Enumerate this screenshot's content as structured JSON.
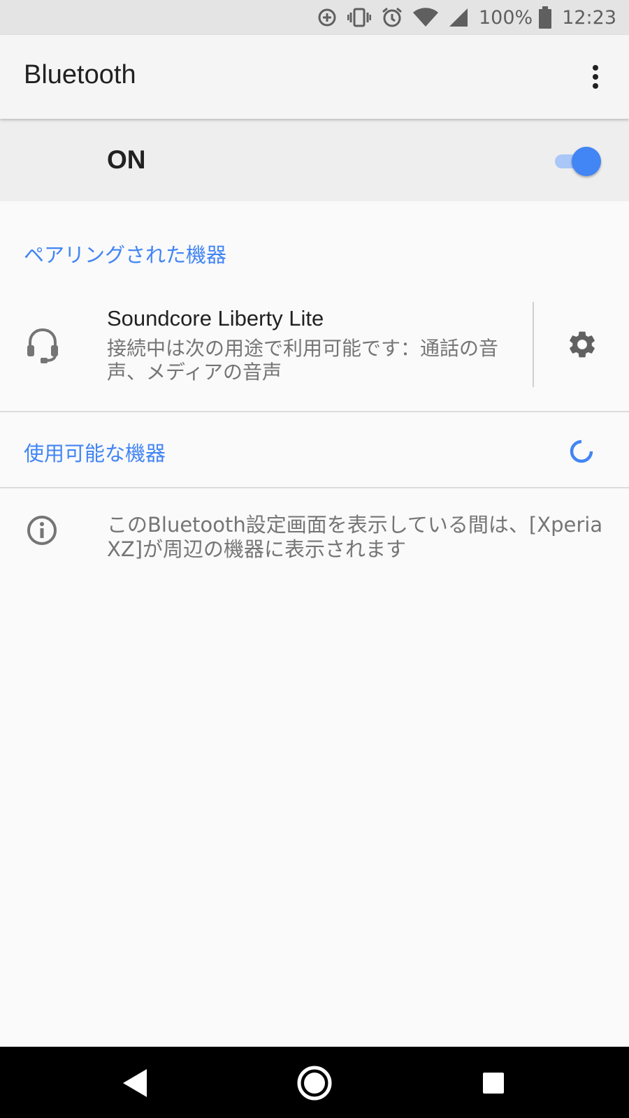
{
  "status_bar": {
    "battery_percent": "100%",
    "time": "12:23",
    "icons": [
      "data-saver-icon",
      "vibrate-icon",
      "alarm-icon",
      "wifi-icon",
      "signal-icon",
      "battery-icon"
    ]
  },
  "app_bar": {
    "title": "Bluetooth",
    "overflow_icon": "more-vert-icon"
  },
  "master_switch": {
    "label": "ON",
    "state": "on",
    "accent": "#4285f4"
  },
  "paired_section": {
    "header": "ペアリングされた機器",
    "device": {
      "name": "Soundcore Liberty Lite",
      "summary": "接続中は次の用途で利用可能です：通話の音声、メディアの音声",
      "icon": "headset-icon",
      "settings_icon": "gear-icon"
    }
  },
  "available_section": {
    "header": "使用可能な機器",
    "progress_icon": "spinner-icon"
  },
  "footer": {
    "info_icon": "info-icon",
    "text": "このBluetooth設定画面を表示している間は、[Xperia XZ]が周辺の機器に表示されます"
  },
  "nav_bar": {
    "icons": [
      "back-icon",
      "home-icon",
      "recents-icon"
    ]
  }
}
